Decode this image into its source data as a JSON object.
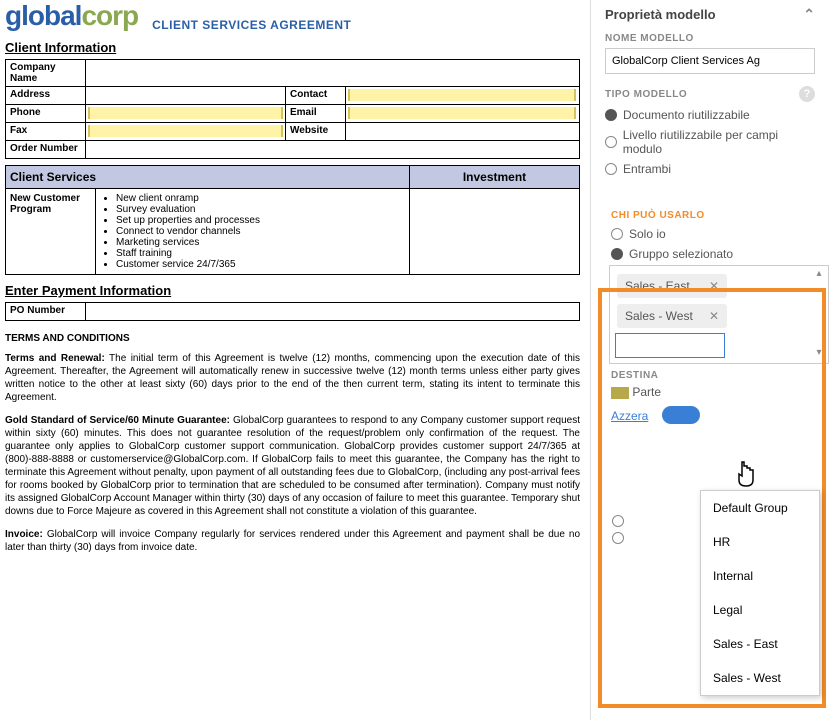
{
  "logo": {
    "part1": "global",
    "part2": "corp",
    "subtitle": "CLIENT SERVICES AGREEMENT"
  },
  "sections": {
    "client_info": "Client Information",
    "payment": "Enter Payment Information"
  },
  "fields": {
    "company": "Company Name",
    "address": "Address",
    "contact": "Contact",
    "phone": "Phone",
    "email": "Email",
    "fax": "Fax",
    "website": "Website",
    "order": "Order Number",
    "po": "PO Number"
  },
  "services": {
    "header1": "Client Services",
    "header2": "Investment",
    "row_label": "New Customer Program",
    "items": [
      "New client onramp",
      "Survey evaluation",
      "Set up properties and processes",
      "Connect to vendor channels",
      "Marketing services",
      "Staff training",
      "Customer service 24/7/365"
    ]
  },
  "tc": {
    "title": "TERMS AND CONDITIONS",
    "p1b": "Terms and Renewal:",
    "p1": "The initial term of this Agreement is twelve (12) months, commencing upon the execution date of this Agreement. Thereafter, the Agreement will automatically renew in successive twelve (12) month terms unless either party gives written notice to the other at least sixty (60) days prior to the end of the then current term, stating its intent to terminate this Agreement.",
    "p2b": "Gold Standard of Service/60 Minute Guarantee:",
    "p2": "GlobalCorp guarantees to respond to any Company customer support request within sixty (60) minutes. This does not guarantee resolution of the request/problem only confirmation of the request. The guarantee only applies to GlobalCorp customer support communication. GlobalCorp provides customer support 24/7/365 at (800)-888-8888 or customerservice@GlobalCorp.com. If GlobalCorp fails to meet this guarantee, the Company has the right to terminate this Agreement without penalty, upon payment of all outstanding fees due to GlobalCorp, (including any post-arrival fees for rooms booked by GlobalCorp prior to termination that are scheduled to be consumed after termination). Company must notify its assigned GlobalCorp Account Manager within thirty (30) days of any occasion of failure to meet this guarantee. Temporary shut downs due to Force Majeure as covered in this Agreement shall not constitute a violation of this guarantee.",
    "p3b": "Invoice:",
    "p3": "GlobalCorp will invoice Company regularly for services rendered under this Agreement and payment shall be due no later than thirty (30) days from invoice date."
  },
  "panel": {
    "title": "Proprietà modello",
    "name_label": "NOME MODELLO",
    "name_value": "GlobalCorp Client Services Ag",
    "type_label": "TIPO MODELLO",
    "type_options": [
      "Documento riutilizzabile",
      "Livello riutilizzabile per campi modulo",
      "Entrambi"
    ],
    "usage_label": "CHI PUÒ USARLO",
    "usage_options": [
      "Solo io",
      "Gruppo selezionato"
    ],
    "chips": [
      "Sales - East",
      "Sales - West"
    ],
    "dest_label": "DESTINA",
    "part_label": "Parte",
    "reset": "Azzera",
    "dropdown": [
      "Default Group",
      "HR",
      "Internal",
      "Legal",
      "Sales - East",
      "Sales - West"
    ]
  }
}
